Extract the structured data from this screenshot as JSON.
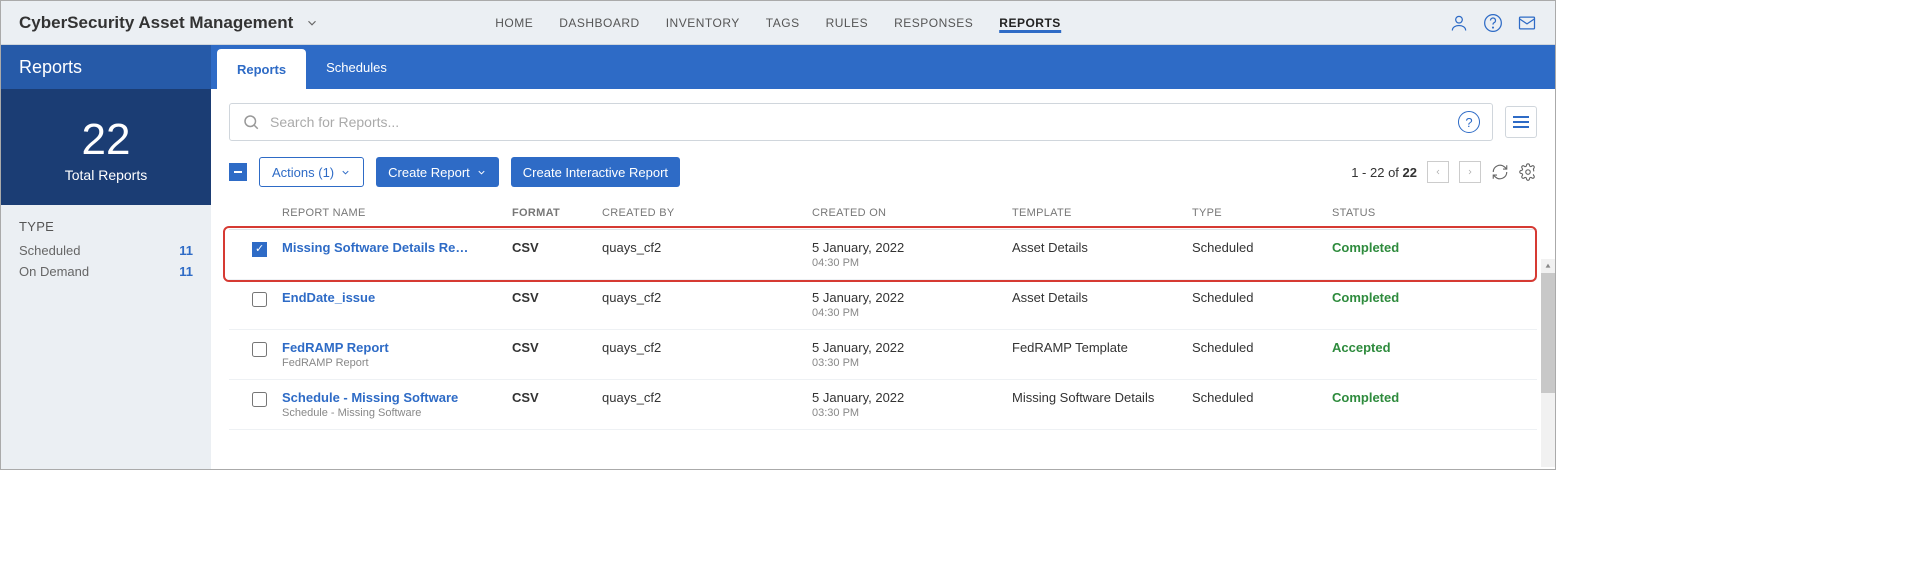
{
  "app_title": "CyberSecurity Asset Management",
  "nav": [
    "HOME",
    "DASHBOARD",
    "INVENTORY",
    "TAGS",
    "RULES",
    "RESPONSES",
    "REPORTS"
  ],
  "nav_active": 6,
  "page_title": "Reports",
  "sub_tabs": [
    "Reports",
    "Schedules"
  ],
  "sub_active": 0,
  "stat": {
    "number": "22",
    "label": "Total Reports"
  },
  "type_panel": {
    "title": "TYPE",
    "rows": [
      {
        "label": "Scheduled",
        "count": "11"
      },
      {
        "label": "On Demand",
        "count": "11"
      }
    ]
  },
  "search_placeholder": "Search for Reports...",
  "toolbar": {
    "actions": "Actions (1)",
    "create": "Create Report",
    "create_interactive": "Create Interactive Report"
  },
  "pagination_text_prefix": "1 - 22 of ",
  "pagination_total": "22",
  "columns": [
    "REPORT NAME",
    "FORMAT",
    "CREATED BY",
    "CREATED ON",
    "TEMPLATE",
    "TYPE",
    "STATUS"
  ],
  "rows": [
    {
      "checked": true,
      "name": "Missing Software Details Re…",
      "sub": "",
      "format": "CSV",
      "by": "quays_cf2",
      "on_date": "5 January, 2022",
      "on_time": "04:30 PM",
      "template": "Asset Details",
      "type": "Scheduled",
      "status": "Completed",
      "status_class": "status-completed"
    },
    {
      "checked": false,
      "name": "EndDate_issue",
      "sub": "",
      "format": "CSV",
      "by": "quays_cf2",
      "on_date": "5 January, 2022",
      "on_time": "04:30 PM",
      "template": "Asset Details",
      "type": "Scheduled",
      "status": "Completed",
      "status_class": "status-completed"
    },
    {
      "checked": false,
      "name": "FedRAMP Report",
      "sub": "FedRAMP Report",
      "format": "CSV",
      "by": "quays_cf2",
      "on_date": "5 January, 2022",
      "on_time": "03:30 PM",
      "template": "FedRAMP Template",
      "type": "Scheduled",
      "status": "Accepted",
      "status_class": "status-accepted"
    },
    {
      "checked": false,
      "name": "Schedule - Missing Software",
      "sub": "Schedule - Missing Software",
      "format": "CSV",
      "by": "quays_cf2",
      "on_date": "5 January, 2022",
      "on_time": "03:30 PM",
      "template": "Missing Software Details",
      "type": "Scheduled",
      "status": "Completed",
      "status_class": "status-completed"
    }
  ]
}
